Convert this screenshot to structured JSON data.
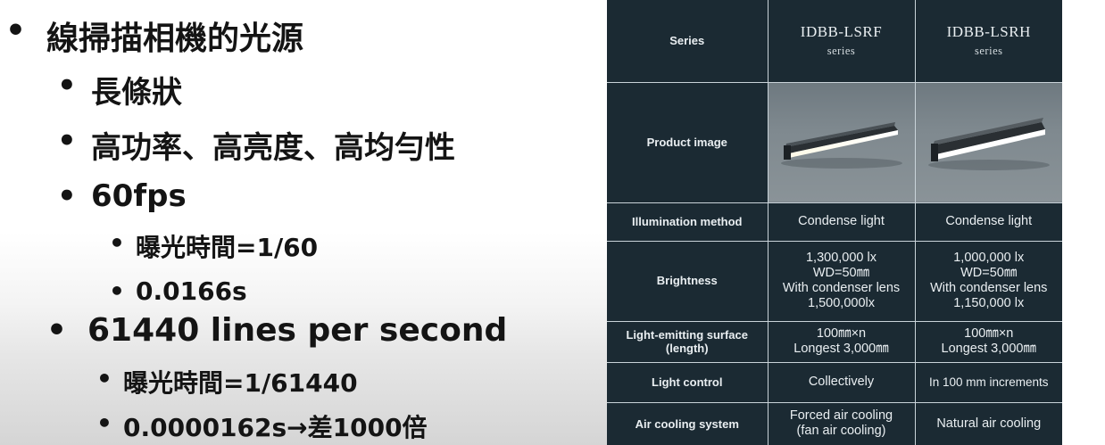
{
  "bullets": [
    {
      "level": 1,
      "dot": "•",
      "text": "線掃描相機的光源"
    },
    {
      "level": 2,
      "dot": "•",
      "text": "長條狀"
    },
    {
      "level": 2,
      "dot": "•",
      "text": "高功率、高亮度、高均勻性"
    },
    {
      "level": 2,
      "dot": "•",
      "text": "60fps"
    },
    {
      "level": 3,
      "dot": "•",
      "text": "曝光時間=1/60"
    },
    {
      "level": 3,
      "dot": "•",
      "text": "0.0166s"
    },
    {
      "level": 1,
      "dot": "•",
      "text": "61440 lines per second"
    },
    {
      "level": 3,
      "dot": "•",
      "text": "曝光時間=1/61440"
    },
    {
      "level": 3,
      "dot": "•",
      "text": "0.0000162s→差1000倍"
    }
  ],
  "table": {
    "rows": {
      "series": {
        "label": "Series",
        "col1": {
          "name": "IDBB-LSRF",
          "sub": "series"
        },
        "col2": {
          "name": "IDBB-LSRH",
          "sub": "series"
        }
      },
      "image": {
        "label": "Product image"
      },
      "illumination": {
        "label": "Illumination method",
        "col1": "Condense light",
        "col2": "Condense light"
      },
      "brightness": {
        "label": "Brightness",
        "col1": [
          "1,300,000 lx",
          "WD=50㎜",
          "With condenser lens",
          "1,500,000lx"
        ],
        "col2": [
          "1,000,000 lx",
          "WD=50㎜",
          "With condenser lens",
          "1,150,000 lx"
        ]
      },
      "surface": {
        "label": [
          "Light-emitting surface",
          "(length)"
        ],
        "col1": [
          "100㎜×n",
          "Longest 3,000㎜"
        ],
        "col2": [
          "100㎜×n",
          "Longest 3,000㎜"
        ]
      },
      "control": {
        "label": "Light control",
        "col1": "Collectively",
        "col2": "In 100 mm increments"
      },
      "cooling": {
        "label": "Air cooling system",
        "col1": [
          "Forced air cooling",
          "(fan air cooling)"
        ],
        "col2": "Natural air cooling"
      }
    }
  },
  "colors": {
    "table_bg": "#1b2a33",
    "table_text": "#e9eef1",
    "grid": "#c9d3d9"
  }
}
